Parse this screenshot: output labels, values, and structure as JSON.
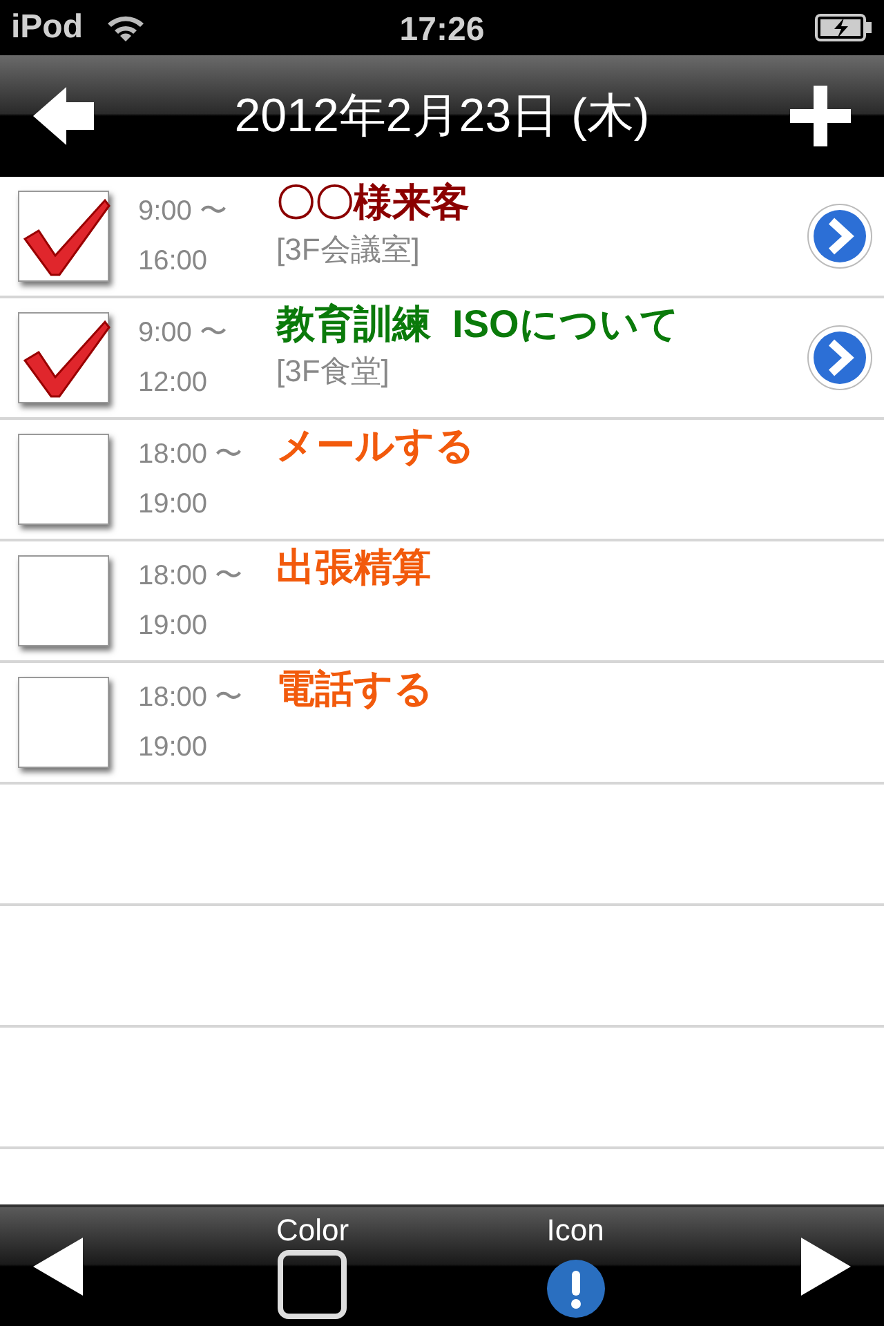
{
  "status_bar": {
    "carrier": "iPod",
    "time": "17:26"
  },
  "nav": {
    "title": "2012年2月23日 (木)"
  },
  "items": [
    {
      "start": "9:00 〜",
      "end": "16:00",
      "title": "〇〇様来客",
      "location": "[3F会議室]",
      "checked": true,
      "color": "#8b0000",
      "detail": true
    },
    {
      "start": "9:00 〜",
      "end": "12:00",
      "title": "教育訓練  ISOについて",
      "location": "[3F食堂]",
      "checked": true,
      "color": "#0a7a0a",
      "detail": true
    },
    {
      "start": "18:00 〜",
      "end": "19:00",
      "title": "メールする",
      "checked": false,
      "color": "#f25a0c",
      "detail": false
    },
    {
      "start": "18:00 〜",
      "end": "19:00",
      "title": "出張精算",
      "checked": false,
      "color": "#f25a0c",
      "detail": false
    },
    {
      "start": "18:00 〜",
      "end": "19:00",
      "title": "電話する",
      "checked": false,
      "color": "#f25a0c",
      "detail": false
    }
  ],
  "toolbar": {
    "color_label": "Color",
    "icon_label": "Icon"
  }
}
